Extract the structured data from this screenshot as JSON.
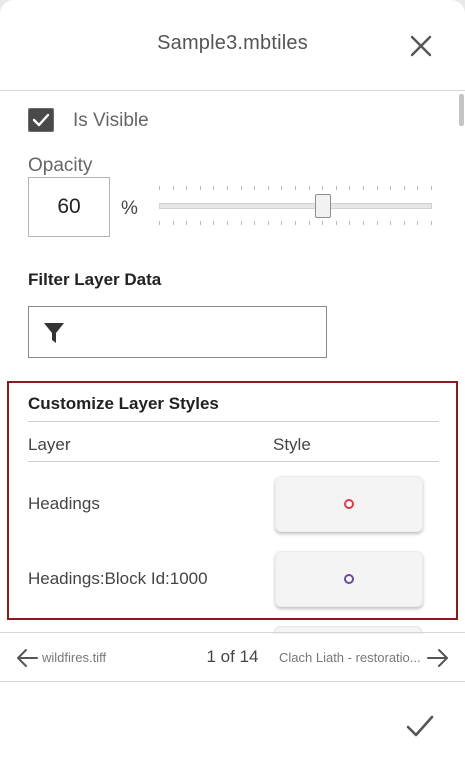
{
  "header": {
    "title": "Sample3.mbtiles",
    "close_icon": "close-icon"
  },
  "visibility": {
    "label": "Is Visible",
    "checked": true
  },
  "opacity": {
    "label": "Opacity",
    "value": "60",
    "unit": "%",
    "slider_percent": 60
  },
  "filter": {
    "heading": "Filter Layer Data",
    "value": "",
    "placeholder": "",
    "icon": "filter-icon"
  },
  "styles": {
    "heading": "Customize Layer Styles",
    "columns": {
      "layer": "Layer",
      "style": "Style"
    },
    "rows": [
      {
        "layer": "Headings",
        "style_color": "#e53a46"
      },
      {
        "layer": "Headings:Block Id:1000",
        "style_color": "#6a4a9e"
      }
    ]
  },
  "nav": {
    "prev_label": "wildfires.tiff",
    "page_text": "1 of 14",
    "next_label": "Clach Liath - restoratio..."
  },
  "footer": {
    "ok_icon": "checkmark-icon"
  },
  "colors": {
    "highlight_border": "#8b1a1a",
    "checkbox_fill": "#4a4a4a"
  }
}
